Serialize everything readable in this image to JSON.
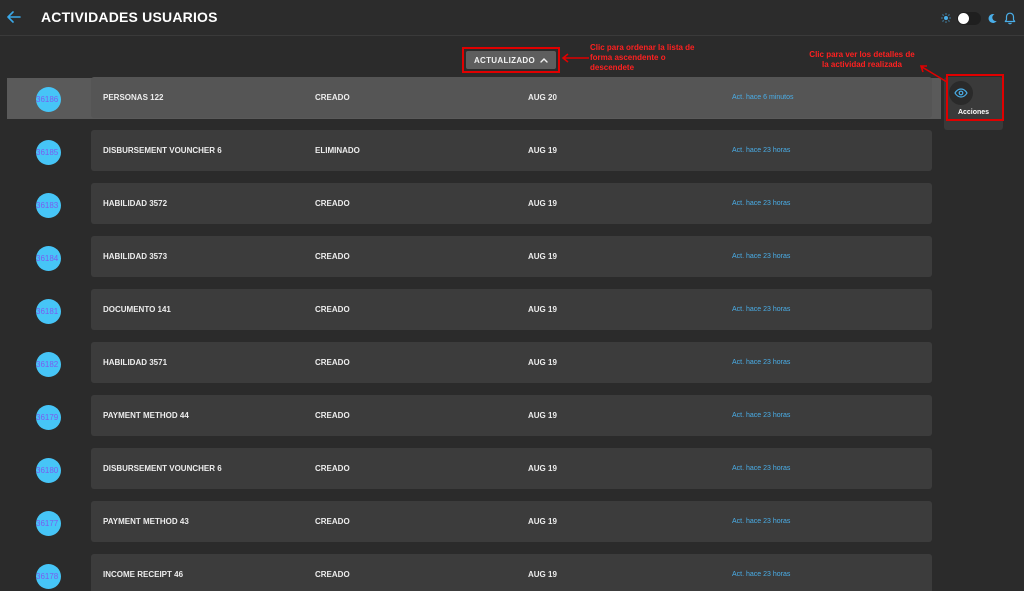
{
  "header": {
    "title": "ACTIVIDADES USUARIOS",
    "back_icon": "arrow-left-icon",
    "accent_color": "#3aa8e8"
  },
  "sort": {
    "label": "ACTUALIZADO"
  },
  "annotations": {
    "sort_note": "Clic para ordenar la lista de forma ascendente o descendete",
    "actions_note": "Clic para ver los detalles de la actividad realizada"
  },
  "actions": {
    "label": "Acciones"
  },
  "rows": [
    {
      "id": "36186",
      "name": "PERSONAS 122",
      "action": "CREADO",
      "date": "AUG 20",
      "ago": "Act. hace 6 minutos"
    },
    {
      "id": "36185",
      "name": "DISBURSEMENT VOUNCHER 6",
      "action": "ELIMINADO",
      "date": "AUG 19",
      "ago": "Act. hace 23 horas"
    },
    {
      "id": "36183",
      "name": "HABILIDAD 3572",
      "action": "CREADO",
      "date": "AUG 19",
      "ago": "Act. hace 23 horas"
    },
    {
      "id": "36184",
      "name": "HABILIDAD 3573",
      "action": "CREADO",
      "date": "AUG 19",
      "ago": "Act. hace 23 horas"
    },
    {
      "id": "36181",
      "name": "DOCUMENTO 141",
      "action": "CREADO",
      "date": "AUG 19",
      "ago": "Act. hace 23 horas"
    },
    {
      "id": "36182",
      "name": "HABILIDAD 3571",
      "action": "CREADO",
      "date": "AUG 19",
      "ago": "Act. hace 23 horas"
    },
    {
      "id": "36179",
      "name": "PAYMENT METHOD 44",
      "action": "CREADO",
      "date": "AUG 19",
      "ago": "Act. hace 23 horas"
    },
    {
      "id": "36180",
      "name": "DISBURSEMENT VOUNCHER 6",
      "action": "CREADO",
      "date": "AUG 19",
      "ago": "Act. hace 23 horas"
    },
    {
      "id": "36177",
      "name": "PAYMENT METHOD 43",
      "action": "CREADO",
      "date": "AUG 19",
      "ago": "Act. hace 23 horas"
    },
    {
      "id": "36178",
      "name": "INCOME RECEIPT 46",
      "action": "CREADO",
      "date": "AUG 19",
      "ago": "Act. hace 23 horas"
    }
  ]
}
